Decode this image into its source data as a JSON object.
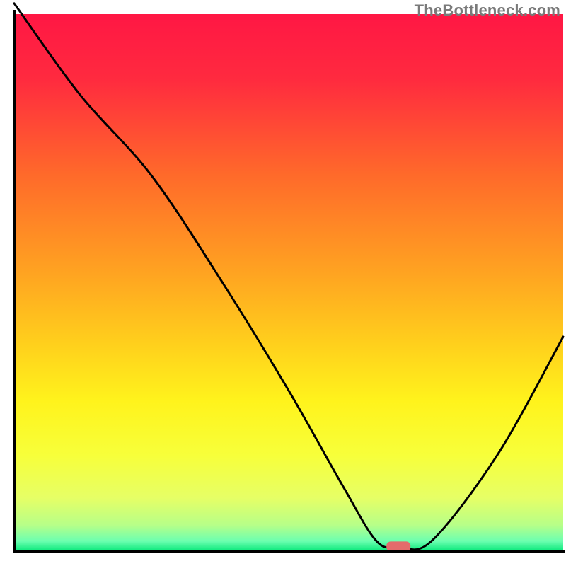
{
  "watermark": "TheBottleneck.com",
  "chart_data": {
    "type": "line",
    "title": "",
    "xlabel": "",
    "ylabel": "",
    "xlim": [
      0,
      100
    ],
    "ylim": [
      0,
      100
    ],
    "x": [
      0,
      12,
      25,
      38,
      50,
      60,
      66,
      70,
      76,
      88,
      100
    ],
    "values": [
      102,
      85,
      70,
      50,
      30,
      12,
      2,
      1,
      2,
      18,
      40
    ],
    "marker": {
      "x": 70,
      "y": 1,
      "color": "#e46b6b"
    },
    "background_gradient": {
      "stops": [
        {
          "offset": 0.0,
          "color": "#ff1744"
        },
        {
          "offset": 0.12,
          "color": "#ff2a3f"
        },
        {
          "offset": 0.3,
          "color": "#ff6a2a"
        },
        {
          "offset": 0.48,
          "color": "#ffa321"
        },
        {
          "offset": 0.62,
          "color": "#ffd21c"
        },
        {
          "offset": 0.72,
          "color": "#fff31c"
        },
        {
          "offset": 0.82,
          "color": "#f7ff3a"
        },
        {
          "offset": 0.9,
          "color": "#e6ff66"
        },
        {
          "offset": 0.95,
          "color": "#b7ff88"
        },
        {
          "offset": 0.98,
          "color": "#6cffb0"
        },
        {
          "offset": 1.0,
          "color": "#00e676"
        }
      ]
    },
    "axis_color": "#000000",
    "curve_color": "#000000"
  }
}
